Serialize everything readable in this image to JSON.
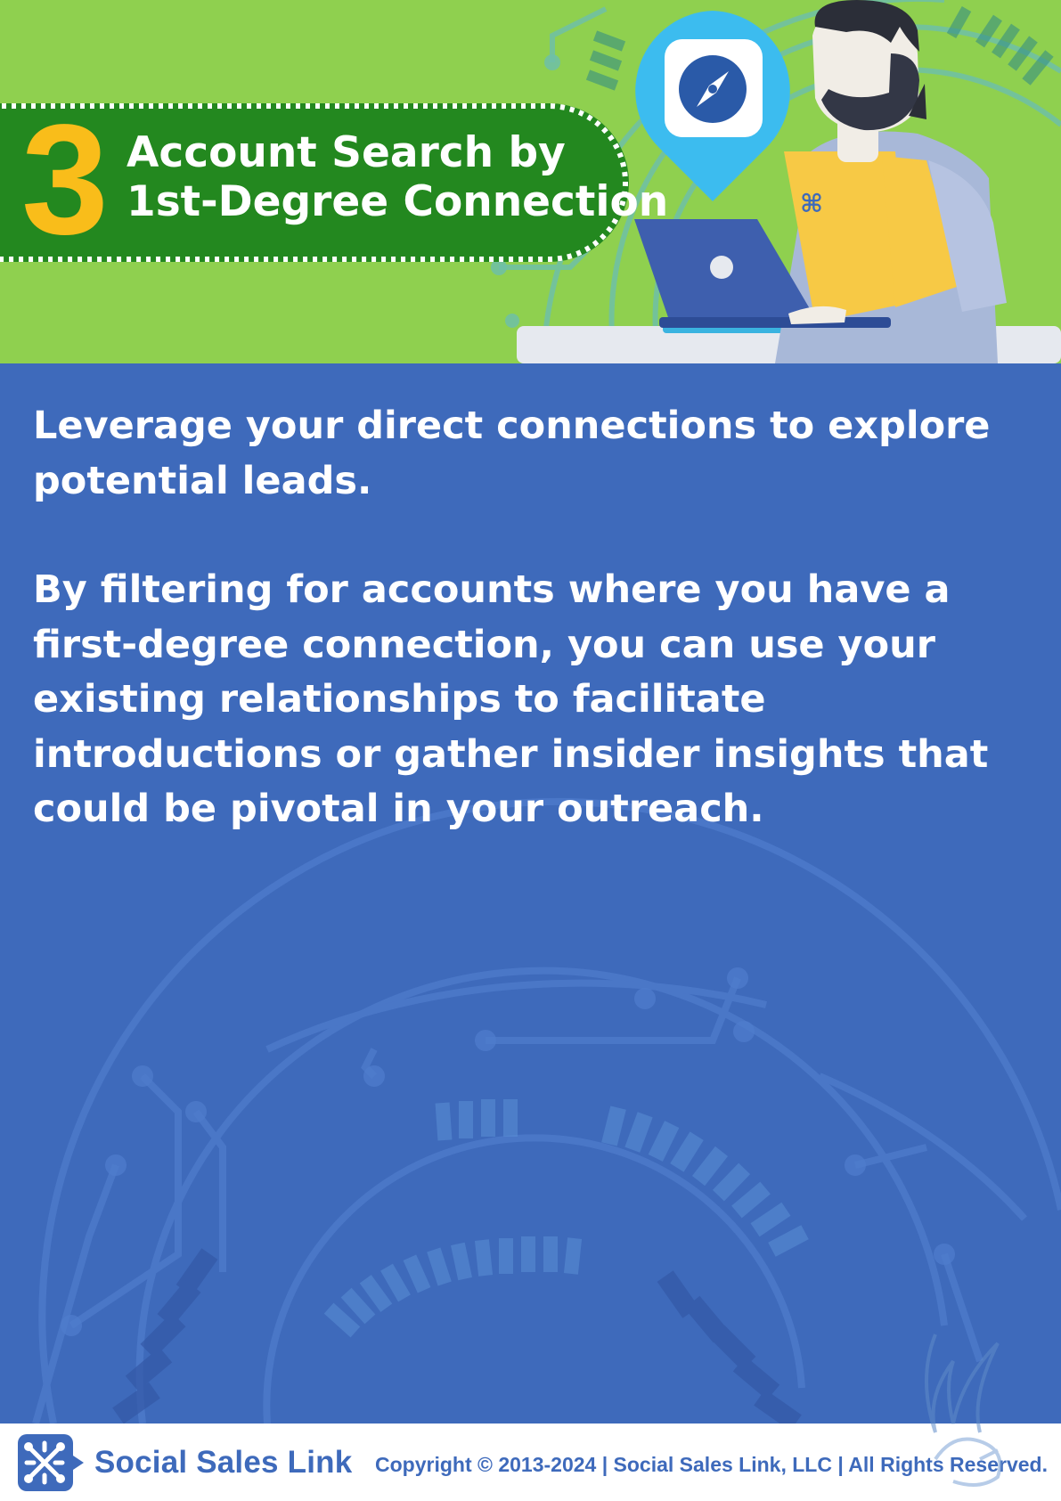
{
  "header": {
    "step_number": "3",
    "title_line1": "Account Search by",
    "title_line2": "1st-Degree Connection",
    "colors": {
      "header_bg": "#8fd04f",
      "banner": "#23881f",
      "number": "#f9bd1a",
      "accent_blue": "#2f5ca8"
    }
  },
  "icons": {
    "pin": "compass-location-pin-icon",
    "person": "person-at-laptop-illustration"
  },
  "body": {
    "paragraph1": "Leverage your direct connections to explore potential leads.",
    "paragraph2": "By filtering for accounts where you have a first-degree connection, you can use your existing relationships to facilitate introductions or gather insider insights that could be pivotal in your outreach.",
    "background_color": "#3e6abb"
  },
  "footer": {
    "brand": "Social Sales Link",
    "copyright": "Copyright © 2013-2024 | Social Sales Link, LLC | All Rights Reserved."
  }
}
